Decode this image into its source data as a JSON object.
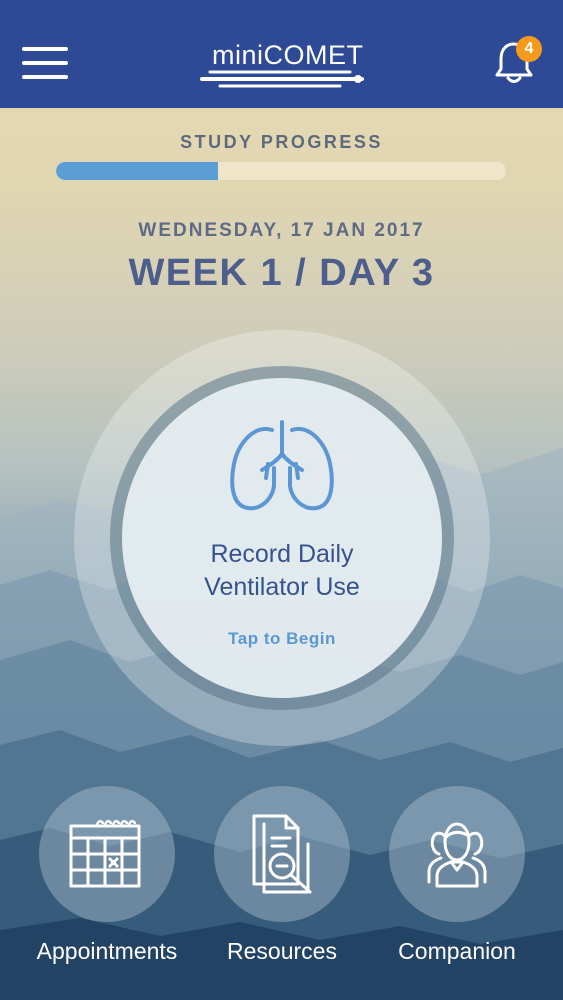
{
  "app": {
    "logo_text_thin": "mini",
    "logo_text_bold": "COMET",
    "notification_count": "4"
  },
  "progress": {
    "label": "STUDY PROGRESS",
    "fraction": 0.36
  },
  "date_line": "WEDNESDAY, 17 JAN 2017",
  "week_day": "WEEK 1 / DAY 3",
  "record": {
    "title_line1": "Record Daily",
    "title_line2": "Ventilator Use",
    "subtitle": "Tap to Begin",
    "icon": "lungs-icon"
  },
  "nav": [
    {
      "label": "Appointments",
      "icon": "calendar-icon"
    },
    {
      "label": "Resources",
      "icon": "document-search-icon"
    },
    {
      "label": "Companion",
      "icon": "people-icon"
    }
  ],
  "colors": {
    "topbar": "#2e4a96",
    "progress_fill": "#5b9ed6",
    "badge": "#f59a1a",
    "heading": "#4e5e8c",
    "record_text": "#37538f",
    "icon_blue": "#5c97d4"
  }
}
